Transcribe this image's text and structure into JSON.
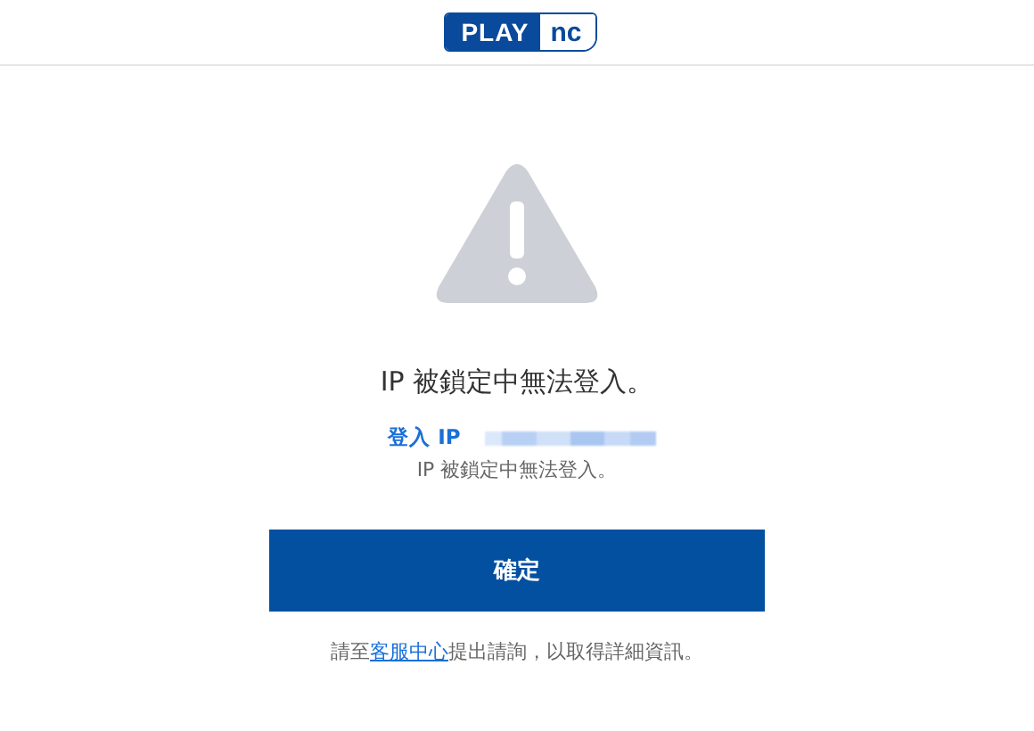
{
  "header": {
    "logo": {
      "left": "PLAY",
      "right": "nc"
    }
  },
  "message": {
    "title": "IP 被鎖定中無法登入。",
    "ip_label": "登入 IP",
    "detail": "IP 被鎖定中無法登入。"
  },
  "confirm_button": "確定",
  "footer": {
    "before": "請至",
    "link": "客服中心",
    "after": "提出請詢，以取得詳細資訊。"
  }
}
